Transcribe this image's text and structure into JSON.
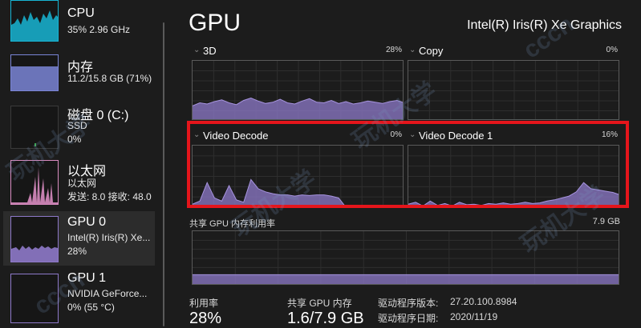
{
  "sidebar": {
    "items": [
      {
        "title": "CPU",
        "line1": "35% 2.96 GHz",
        "line2": "",
        "line3": ""
      },
      {
        "title": "内存",
        "line1": "11.2/15.8 GB (71%)",
        "line2": "",
        "line3": ""
      },
      {
        "title": "磁盘 0 (C:)",
        "line1": "SSD",
        "line2": "0%",
        "line3": ""
      },
      {
        "title": "以太网",
        "line1": "以太网",
        "line2": "发送: 8.0 接收: 48.0",
        "line3": ""
      },
      {
        "title": "GPU 0",
        "line1": "Intel(R) Iris(R) Xe...",
        "line2": "28%",
        "line3": ""
      },
      {
        "title": "GPU 1",
        "line1": "NVIDIA GeForce...",
        "line2": "0% (55 °C)",
        "line3": ""
      }
    ],
    "selected_index": 4
  },
  "main": {
    "title": "GPU",
    "adapter": "Intel(R) Iris(R) Xe Graphics",
    "engines": [
      {
        "label": "3D",
        "percent": "28%"
      },
      {
        "label": "Copy",
        "percent": "0%"
      },
      {
        "label": "Video Decode",
        "percent": "0%"
      },
      {
        "label": "Video Decode 1",
        "percent": "16%"
      }
    ],
    "shared_memory": {
      "label": "共享 GPU 内存利用率",
      "max": "7.9 GB"
    },
    "stats": {
      "utilization_label": "利用率",
      "utilization_value": "28%",
      "shared_mem_label": "共享 GPU 内存",
      "shared_mem_value": "1.6/7.9 GB",
      "driver_version_label": "驱动程序版本:",
      "driver_version_value": "27.20.100.8984",
      "driver_date_label": "驱动程序日期:",
      "driver_date_value": "2020/11/19"
    }
  },
  "colors": {
    "gpu": "#8e79c9",
    "gpu_line": "#a794e0",
    "cpu": "#17b5d4",
    "memory": "#7a85d6",
    "disk": "#3aa64a",
    "network": "#d88bc0",
    "highlight": "#e5151b"
  },
  "watermarks": [
    "玩机大学",
    "cccn"
  ],
  "utilization_series": {
    "3d": [
      0.25,
      0.3,
      0.28,
      0.32,
      0.35,
      0.3,
      0.27,
      0.34,
      0.38,
      0.33,
      0.29,
      0.31,
      0.36,
      0.3,
      0.28,
      0.33,
      0.37,
      0.31,
      0.3,
      0.34,
      0.29,
      0.32,
      0.28,
      0.3,
      0.33,
      0.31,
      0.29,
      0.32,
      0.34,
      0.3
    ],
    "copy": [
      0,
      0,
      0,
      0,
      0,
      0,
      0,
      0,
      0,
      0,
      0,
      0,
      0,
      0,
      0,
      0,
      0,
      0,
      0,
      0,
      0,
      0,
      0,
      0,
      0,
      0,
      0,
      0,
      0,
      0
    ],
    "video_decode": [
      0.05,
      0.1,
      0.4,
      0.15,
      0.1,
      0.35,
      0.12,
      0.08,
      0.45,
      0.3,
      0.25,
      0.22,
      0.2,
      0.2,
      0.18,
      0.2,
      0.19,
      0.2,
      0.2,
      0.18,
      0.15,
      0.0,
      0.0,
      0.0,
      0.0,
      0.0,
      0.0,
      0.0,
      0.0,
      0.0
    ],
    "video_decode_1": [
      0.05,
      0.08,
      0.02,
      0.1,
      0.03,
      0.06,
      0.02,
      0.08,
      0.04,
      0.05,
      0.03,
      0.06,
      0.05,
      0.07,
      0.05,
      0.06,
      0.08,
      0.06,
      0.07,
      0.1,
      0.12,
      0.15,
      0.18,
      0.25,
      0.4,
      0.3,
      0.28,
      0.26,
      0.24,
      0.2
    ],
    "shared_memory": [
      0.2,
      0.2,
      0.2,
      0.2,
      0.2,
      0.2,
      0.2,
      0.2,
      0.2,
      0.2,
      0.2,
      0.2,
      0.2,
      0.2,
      0.2,
      0.2,
      0.2,
      0.2,
      0.2,
      0.2
    ]
  }
}
